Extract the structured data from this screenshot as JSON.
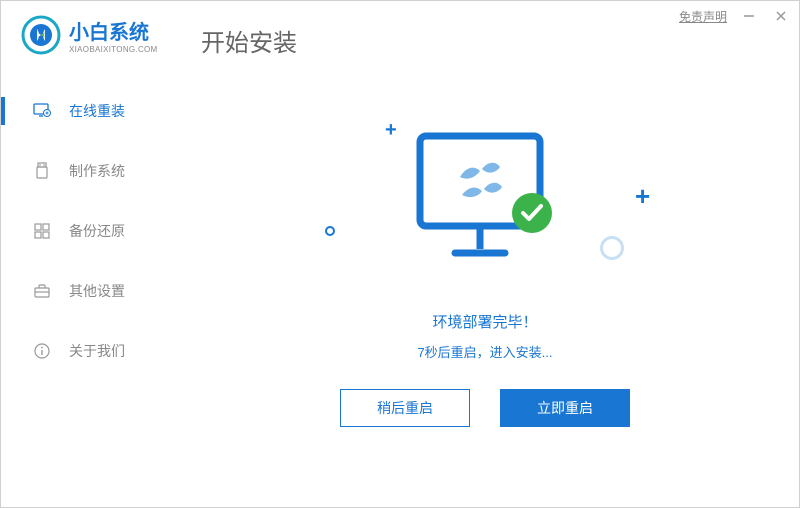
{
  "titlebar": {
    "disclaimer": "免责声明"
  },
  "logo": {
    "main": "小白系统",
    "sub": "XIAOBAIXITONG.COM"
  },
  "page_title": "开始安装",
  "sidebar": {
    "items": [
      {
        "label": "在线重装"
      },
      {
        "label": "制作系统"
      },
      {
        "label": "备份还原"
      },
      {
        "label": "其他设置"
      },
      {
        "label": "关于我们"
      }
    ]
  },
  "main": {
    "status1": "环境部署完毕！",
    "status2": "7秒后重启，进入安装...",
    "later_btn": "稍后重启",
    "now_btn": "立即重启"
  }
}
